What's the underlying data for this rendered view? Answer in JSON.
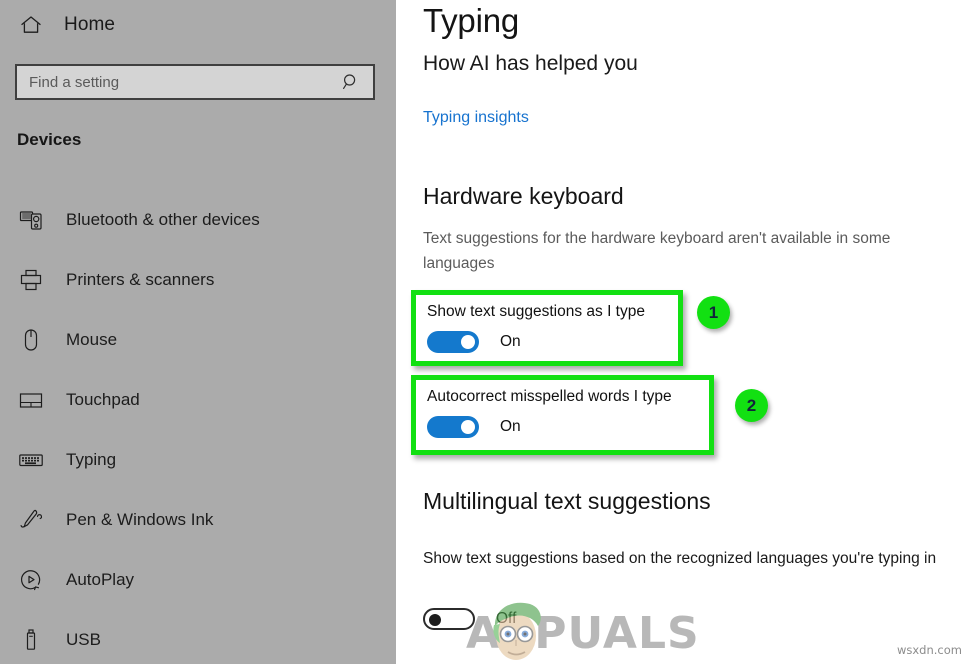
{
  "sidebar": {
    "home": {
      "label": "Home",
      "icon": "home-icon"
    },
    "search": {
      "placeholder": "Find a setting",
      "value": "",
      "icon": "search-icon"
    },
    "section_heading": "Devices",
    "items": [
      {
        "label": "Bluetooth & other devices",
        "icon": "bluetooth-devices-icon"
      },
      {
        "label": "Printers & scanners",
        "icon": "printer-icon"
      },
      {
        "label": "Mouse",
        "icon": "mouse-icon"
      },
      {
        "label": "Touchpad",
        "icon": "touchpad-icon"
      },
      {
        "label": "Typing",
        "icon": "keyboard-icon"
      },
      {
        "label": "Pen & Windows Ink",
        "icon": "pen-icon"
      },
      {
        "label": "AutoPlay",
        "icon": "autoplay-icon"
      },
      {
        "label": "USB",
        "icon": "usb-icon"
      }
    ]
  },
  "main": {
    "title": "Typing",
    "subtitle": "How AI has helped you",
    "link": "Typing insights",
    "hardware_keyboard": {
      "heading": "Hardware keyboard",
      "description": "Text suggestions for the hardware keyboard aren't available in some languages",
      "settings": [
        {
          "label": "Show text suggestions as I type",
          "state": "On",
          "badge": "1"
        },
        {
          "label": "Autocorrect misspelled words I type",
          "state": "On",
          "badge": "2"
        }
      ]
    },
    "multilingual": {
      "heading": "Multilingual text suggestions",
      "description": "Show text suggestions based on the recognized languages you're typing in",
      "setting": {
        "state": "Off"
      }
    }
  },
  "watermark": {
    "brand": "APPUALS",
    "corner_url": "wsxdn.com"
  },
  "colors": {
    "sidebar_bg": "#ababab",
    "accent_blue": "#1479cd",
    "link_blue": "#1773cf",
    "highlight_green": "#12e012",
    "badge_text": "#12233b"
  }
}
